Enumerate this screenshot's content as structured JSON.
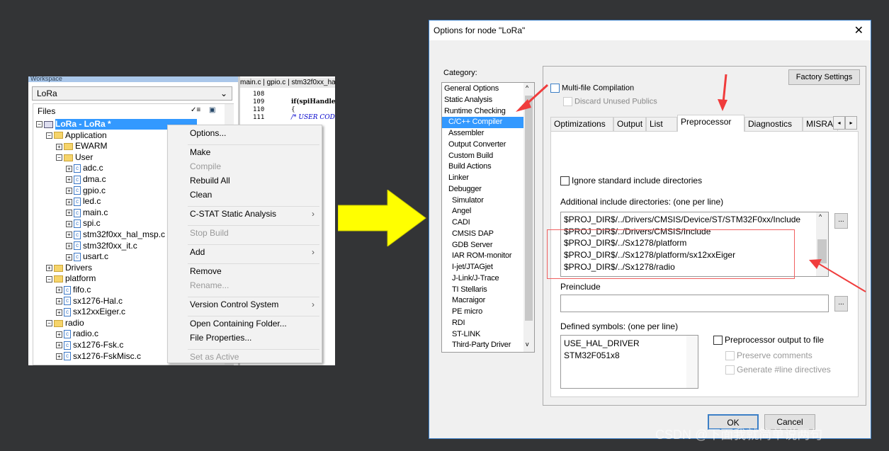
{
  "workspace": {
    "title": "Workspace",
    "config": "LoRa",
    "files_header": "Files",
    "tree": [
      {
        "label": "LoRa - LoRa *",
        "type": "project",
        "depth": 0,
        "expanded": true,
        "selected": true
      },
      {
        "label": "Application",
        "type": "folder",
        "depth": 1,
        "expanded": true
      },
      {
        "label": "EWARM",
        "type": "folder",
        "depth": 2,
        "expanded": false
      },
      {
        "label": "User",
        "type": "folder",
        "depth": 2,
        "expanded": true
      },
      {
        "label": "adc.c",
        "type": "file",
        "depth": 3
      },
      {
        "label": "dma.c",
        "type": "file",
        "depth": 3
      },
      {
        "label": "gpio.c",
        "type": "file",
        "depth": 3
      },
      {
        "label": "led.c",
        "type": "file",
        "depth": 3
      },
      {
        "label": "main.c",
        "type": "file",
        "depth": 3
      },
      {
        "label": "spi.c",
        "type": "file",
        "depth": 3
      },
      {
        "label": "stm32f0xx_hal_msp.c",
        "type": "file",
        "depth": 3
      },
      {
        "label": "stm32f0xx_it.c",
        "type": "file",
        "depth": 3
      },
      {
        "label": "usart.c",
        "type": "file",
        "depth": 3
      },
      {
        "label": "Drivers",
        "type": "folder",
        "depth": 1,
        "expanded": false
      },
      {
        "label": "platform",
        "type": "folder",
        "depth": 1,
        "expanded": true
      },
      {
        "label": "fifo.c",
        "type": "file",
        "depth": 2
      },
      {
        "label": "sx1276-Hal.c",
        "type": "file",
        "depth": 2
      },
      {
        "label": "sx12xxEiger.c",
        "type": "file",
        "depth": 2
      },
      {
        "label": "radio",
        "type": "folder",
        "depth": 1,
        "expanded": true
      },
      {
        "label": "radio.c",
        "type": "file",
        "depth": 2
      },
      {
        "label": "sx1276-Fsk.c",
        "type": "file",
        "depth": 2
      },
      {
        "label": "sx1276-FskMisc.c",
        "type": "file",
        "depth": 2
      }
    ]
  },
  "editor": {
    "tabs": "main.c | gpio.c | stm32f0xx_ha",
    "line_numbers": [
      "108",
      "109",
      "110",
      "111"
    ],
    "code": [
      "if(spiHandle",
      "{",
      "/* USER CODE"
    ]
  },
  "context_menu": [
    {
      "label": "Options...",
      "enabled": true
    },
    {
      "sep": true
    },
    {
      "label": "Make",
      "enabled": true
    },
    {
      "label": "Compile",
      "enabled": false
    },
    {
      "label": "Rebuild All",
      "enabled": true
    },
    {
      "label": "Clean",
      "enabled": true
    },
    {
      "sep": true
    },
    {
      "label": "C-STAT Static Analysis",
      "enabled": true,
      "submenu": true
    },
    {
      "sep": true
    },
    {
      "label": "Stop Build",
      "enabled": false
    },
    {
      "sep": true
    },
    {
      "label": "Add",
      "enabled": true,
      "submenu": true
    },
    {
      "sep": true
    },
    {
      "label": "Remove",
      "enabled": true
    },
    {
      "label": "Rename...",
      "enabled": false
    },
    {
      "sep": true
    },
    {
      "label": "Version Control System",
      "enabled": true,
      "submenu": true
    },
    {
      "sep": true
    },
    {
      "label": "Open Containing Folder...",
      "enabled": true
    },
    {
      "label": "File Properties...",
      "enabled": true
    },
    {
      "sep": true
    },
    {
      "label": "Set as Active",
      "enabled": false
    }
  ],
  "dialog": {
    "title": "Options for node \"LoRa\"",
    "close": "✕",
    "category_label": "Category:",
    "categories": [
      {
        "label": "General Options"
      },
      {
        "label": "Static Analysis"
      },
      {
        "label": "Runtime Checking"
      },
      {
        "label": "C/C++ Compiler",
        "selected": true
      },
      {
        "label": "Assembler",
        "indent": true
      },
      {
        "label": "Output Converter",
        "indent": true
      },
      {
        "label": "Custom Build",
        "indent": true
      },
      {
        "label": "Build Actions",
        "indent": true
      },
      {
        "label": "Linker",
        "indent": true
      },
      {
        "label": "Debugger",
        "indent": true
      },
      {
        "label": "Simulator",
        "indent": 2
      },
      {
        "label": "Angel",
        "indent": 2
      },
      {
        "label": "CADI",
        "indent": 2
      },
      {
        "label": "CMSIS DAP",
        "indent": 2
      },
      {
        "label": "GDB Server",
        "indent": 2
      },
      {
        "label": "IAR ROM-monitor",
        "indent": 2
      },
      {
        "label": "I-jet/JTAGjet",
        "indent": 2
      },
      {
        "label": "J-Link/J-Trace",
        "indent": 2
      },
      {
        "label": "TI Stellaris",
        "indent": 2
      },
      {
        "label": "Macraigor",
        "indent": 2
      },
      {
        "label": "PE micro",
        "indent": 2
      },
      {
        "label": "RDI",
        "indent": 2
      },
      {
        "label": "ST-LINK",
        "indent": 2
      },
      {
        "label": "Third-Party Driver",
        "indent": 2
      }
    ],
    "factory_settings": "Factory Settings",
    "multi_file": "Multi-file Compilation",
    "discard_unused": "Discard Unused Publics",
    "tabs": [
      "Optimizations",
      "Output",
      "List",
      "Preprocessor",
      "Diagnostics",
      "MISRA"
    ],
    "active_tab": "Preprocessor",
    "ignore_std": "Ignore standard include directories",
    "include_label": "Additional include directories: (one per line)",
    "include_dirs": [
      "$PROJ_DIR$/../Drivers/CMSIS/Device/ST/STM32F0xx/Include",
      "$PROJ_DIR$/../Drivers/CMSIS/Include",
      "$PROJ_DIR$/../Sx1278/platform",
      "$PROJ_DIR$/../Sx1278/platform/sx12xxEiger",
      "$PROJ_DIR$/../Sx1278/radio"
    ],
    "browse": "...",
    "preinclude_label": "Preinclude",
    "preinclude_value": "",
    "defined_label": "Defined symbols: (one per line)",
    "defined_symbols": [
      "USE_HAL_DRIVER",
      "STM32F051x8"
    ],
    "pp_output": "Preprocessor output to file",
    "preserve_comments": "Preserve comments",
    "generate_line": "Generate #line directives",
    "ok": "OK",
    "cancel": "Cancel"
  },
  "watermark": "CSDN @下面我就简单说两句",
  "colors": {
    "selection": "#3399ff",
    "annotation": "#f03c3c",
    "arrow": "#ffff00"
  }
}
